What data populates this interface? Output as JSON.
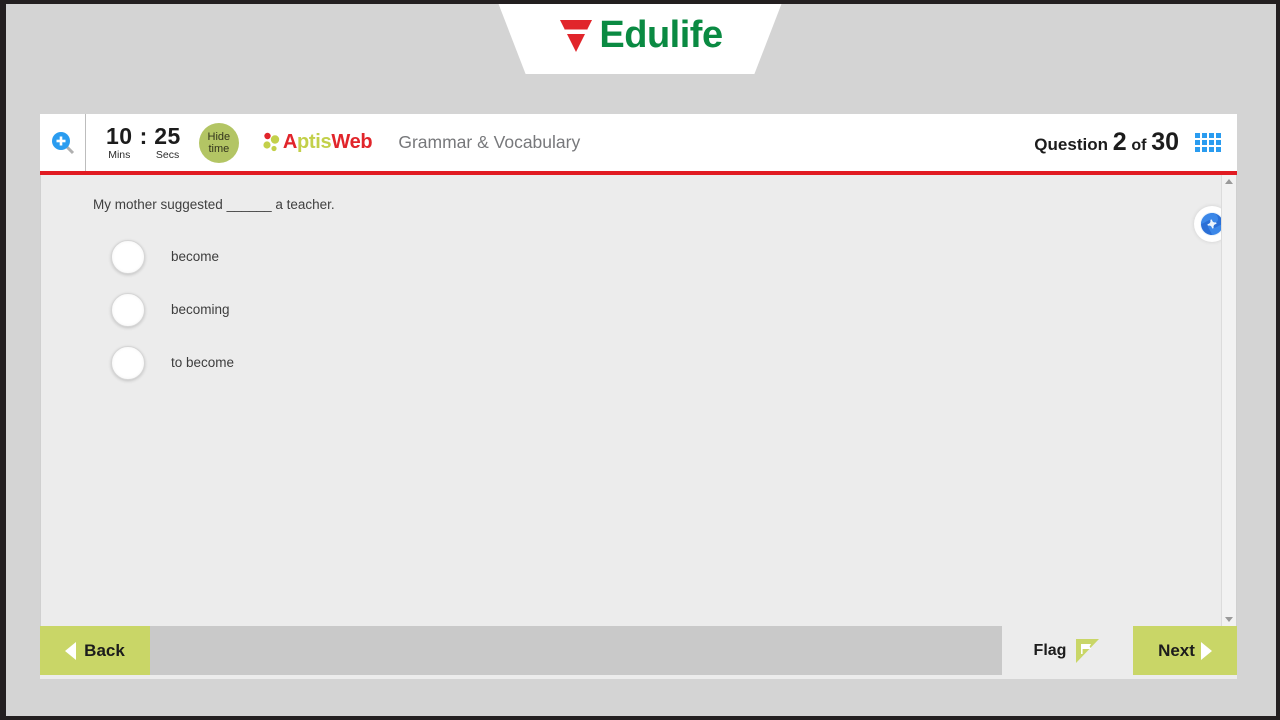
{
  "header": {
    "brand_name": "Edulife",
    "brand_green": "#0a8a42",
    "brand_red": "#e1252b",
    "logo_icon": "edulife-triangle-logo"
  },
  "toolbar": {
    "zoom_icon": "magnifier-plus-icon",
    "timer": {
      "minutes": "10",
      "separator": ":",
      "seconds": "25",
      "minutes_label": "Mins",
      "seconds_label": "Secs"
    },
    "hide_time_button": {
      "line1": "Hide",
      "line2": "time",
      "color": "#b3c564"
    },
    "aptis_logo": {
      "part_a": "A",
      "part_ptis": "ptis",
      "part_web": "Web",
      "dots_icon": "aptis-dots-icon"
    },
    "section_title": "Grammar & Vocabulary",
    "question_counter": {
      "prefix": "Question",
      "current": "2",
      "middle": "of",
      "total": "30"
    },
    "grid_icon": "question-grid-icon",
    "accent_line_color": "#e11b22"
  },
  "content": {
    "question_text": "My mother suggested ______ a teacher.",
    "options": [
      {
        "label": "become",
        "selected": false
      },
      {
        "label": "becoming",
        "selected": false
      },
      {
        "label": "to become",
        "selected": false
      }
    ],
    "swirl_icon": "blue-spiral-icon",
    "scrollbar": {
      "up_arrow_icon": "scroll-up-arrow-icon",
      "down_arrow_icon": "scroll-down-arrow-icon"
    }
  },
  "bottom_bar": {
    "back_label": "Back",
    "back_icon": "arrow-left-icon",
    "flag_label": "Flag",
    "flag_icon": "flag-icon",
    "next_label": "Next",
    "next_icon": "arrow-right-icon",
    "button_color": "#c9d667"
  }
}
